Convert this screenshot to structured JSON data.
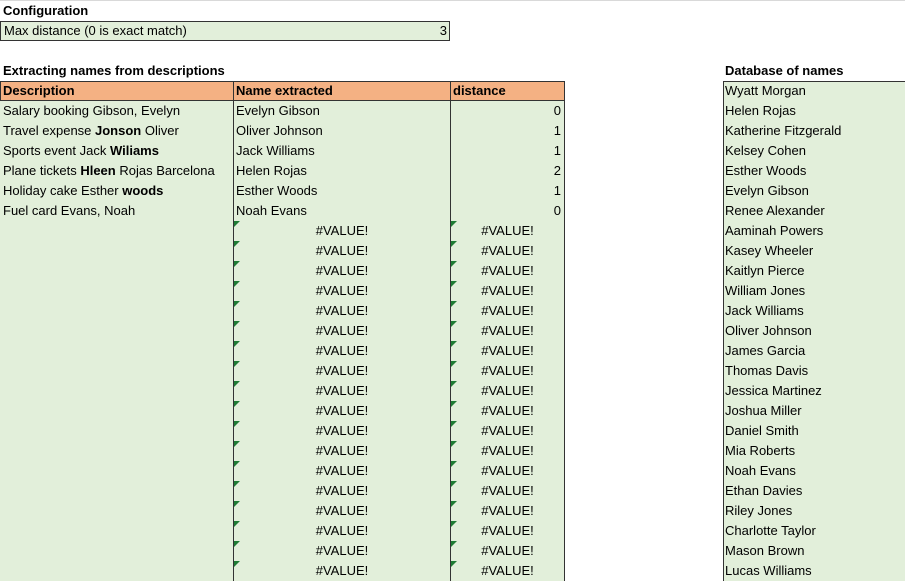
{
  "config": {
    "title": "Configuration",
    "max_distance_label": "Max distance (0 is exact match)",
    "max_distance_value": "3"
  },
  "extract": {
    "title": "Extracting names from descriptions",
    "headers": {
      "description": "Description",
      "name_extracted": "Name extracted",
      "distance": "distance"
    },
    "rows": [
      {
        "desc_parts": [
          [
            "Salary booking Gibson, Evelyn",
            false
          ]
        ],
        "name": "Evelyn Gibson",
        "distance": "0"
      },
      {
        "desc_parts": [
          [
            "Travel expense ",
            false
          ],
          [
            "Jonson",
            true
          ],
          [
            " Oliver",
            false
          ]
        ],
        "name": "Oliver Johnson",
        "distance": "1"
      },
      {
        "desc_parts": [
          [
            "Sports event Jack ",
            false
          ],
          [
            "Wiliams",
            true
          ]
        ],
        "name": "Jack Williams",
        "distance": "1"
      },
      {
        "desc_parts": [
          [
            "Plane tickets ",
            false
          ],
          [
            "Hleen",
            true
          ],
          [
            " Rojas Barcelona",
            false
          ]
        ],
        "name": "Helen Rojas",
        "distance": "2"
      },
      {
        "desc_parts": [
          [
            "Holiday cake Esther ",
            false
          ],
          [
            "woods",
            true
          ]
        ],
        "name": "Esther Woods",
        "distance": "1"
      },
      {
        "desc_parts": [
          [
            "Fuel card Evans,  Noah",
            false
          ]
        ],
        "name": "Noah Evans",
        "distance": "0"
      }
    ],
    "error_value": "#VALUE!",
    "error_row_count": 18
  },
  "database": {
    "title": "Database of names",
    "names": [
      "Wyatt Morgan",
      "Helen Rojas",
      "Katherine Fitzgerald",
      "Kelsey Cohen",
      "Esther Woods",
      "Evelyn Gibson",
      "Renee Alexander",
      "Aaminah Powers",
      "Kasey Wheeler",
      "Kaitlyn Pierce",
      "William Jones",
      "Jack Williams",
      "Oliver Johnson",
      "James Garcia",
      "Thomas Davis",
      "Jessica Martinez",
      "Joshua Miller",
      "Daniel Smith",
      "Mia Roberts",
      "Noah Evans",
      "Ethan Davies",
      "Riley Jones",
      "Charlotte Taylor",
      "Mason Brown",
      "Lucas Williams"
    ]
  },
  "colors": {
    "header_orange": "#f4b183",
    "cell_green": "#e2efda",
    "error_flag": "#1e7b34"
  }
}
